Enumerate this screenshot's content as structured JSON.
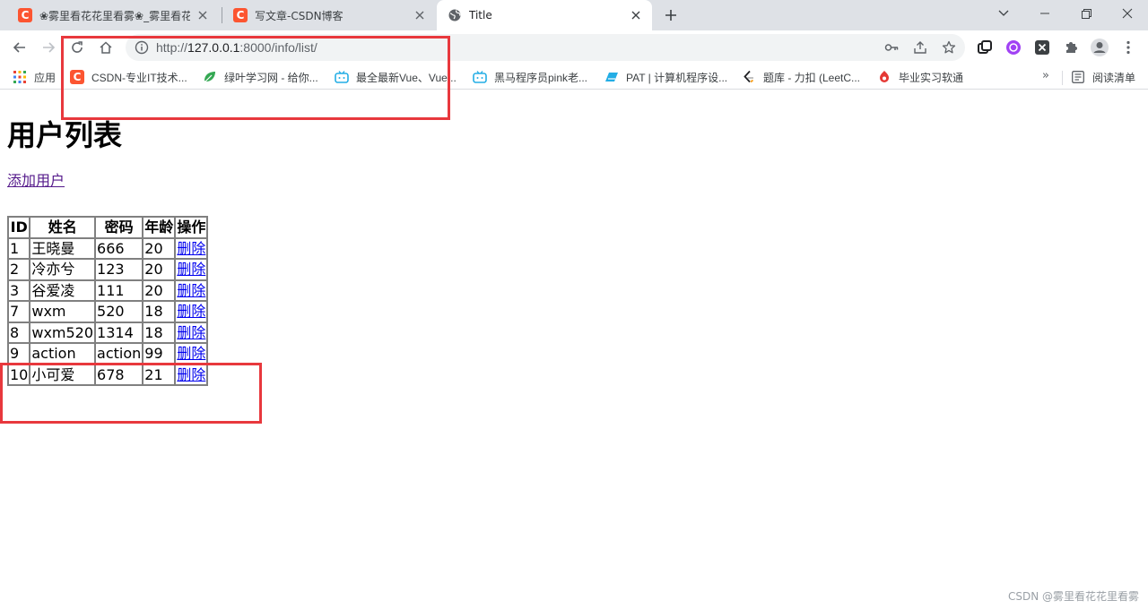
{
  "browser": {
    "tabs": [
      {
        "title": "❀雾里看花花里看雾❀_雾里看花",
        "favicon": "csdn-icon",
        "active": false
      },
      {
        "title": "写文章-CSDN博客",
        "favicon": "csdn-icon",
        "active": false
      },
      {
        "title": "Title",
        "favicon": "globe-icon",
        "active": true
      }
    ],
    "address_bar": {
      "scheme": "http://",
      "host": "127.0.0.1",
      "path": ":8000/info/list/"
    },
    "bookmarks": [
      {
        "label": "应用",
        "icon": "apps-grid-icon"
      },
      {
        "label": "CSDN-专业IT技术...",
        "icon": "csdn-icon"
      },
      {
        "label": "绿叶学习网 - 给你...",
        "icon": "leaf-icon"
      },
      {
        "label": "最全最新Vue、Vue...",
        "icon": "bilibili-icon"
      },
      {
        "label": "黑马程序员pink老...",
        "icon": "bilibili-icon"
      },
      {
        "label": "PAT | 计算机程序设...",
        "icon": "pat-icon"
      },
      {
        "label": "题库 - 力扣 (LeetC...",
        "icon": "leetcode-icon"
      },
      {
        "label": "毕业实习软通",
        "icon": "isoftstone-icon"
      }
    ],
    "bookmarks_more": "»",
    "reading_list": "阅读清单"
  },
  "page": {
    "heading": "用户列表",
    "add_link": "添加用户",
    "table": {
      "headers": [
        "ID",
        "姓名",
        "密码",
        "年龄",
        "操作"
      ],
      "rows": [
        {
          "id": "1",
          "name": "王晓曼",
          "password": "666",
          "age": "20",
          "action": "删除"
        },
        {
          "id": "2",
          "name": "冷亦兮",
          "password": "123",
          "age": "20",
          "action": "删除"
        },
        {
          "id": "3",
          "name": "谷爱凌",
          "password": "111",
          "age": "20",
          "action": "删除"
        },
        {
          "id": "7",
          "name": "wxm",
          "password": "520",
          "age": "18",
          "action": "删除"
        },
        {
          "id": "8",
          "name": "wxm520",
          "password": "1314",
          "age": "18",
          "action": "删除"
        },
        {
          "id": "9",
          "name": "action",
          "password": "action",
          "age": "99",
          "action": "删除"
        },
        {
          "id": "10",
          "name": "小可爱",
          "password": "678",
          "age": "21",
          "action": "删除"
        }
      ]
    }
  },
  "watermark": "CSDN @雾里看花花里看雾",
  "colors": {
    "annotation": "#e8383d",
    "link": "#0000ee",
    "visited_link": "#551a8b",
    "csdn_brand": "#fc5531"
  }
}
